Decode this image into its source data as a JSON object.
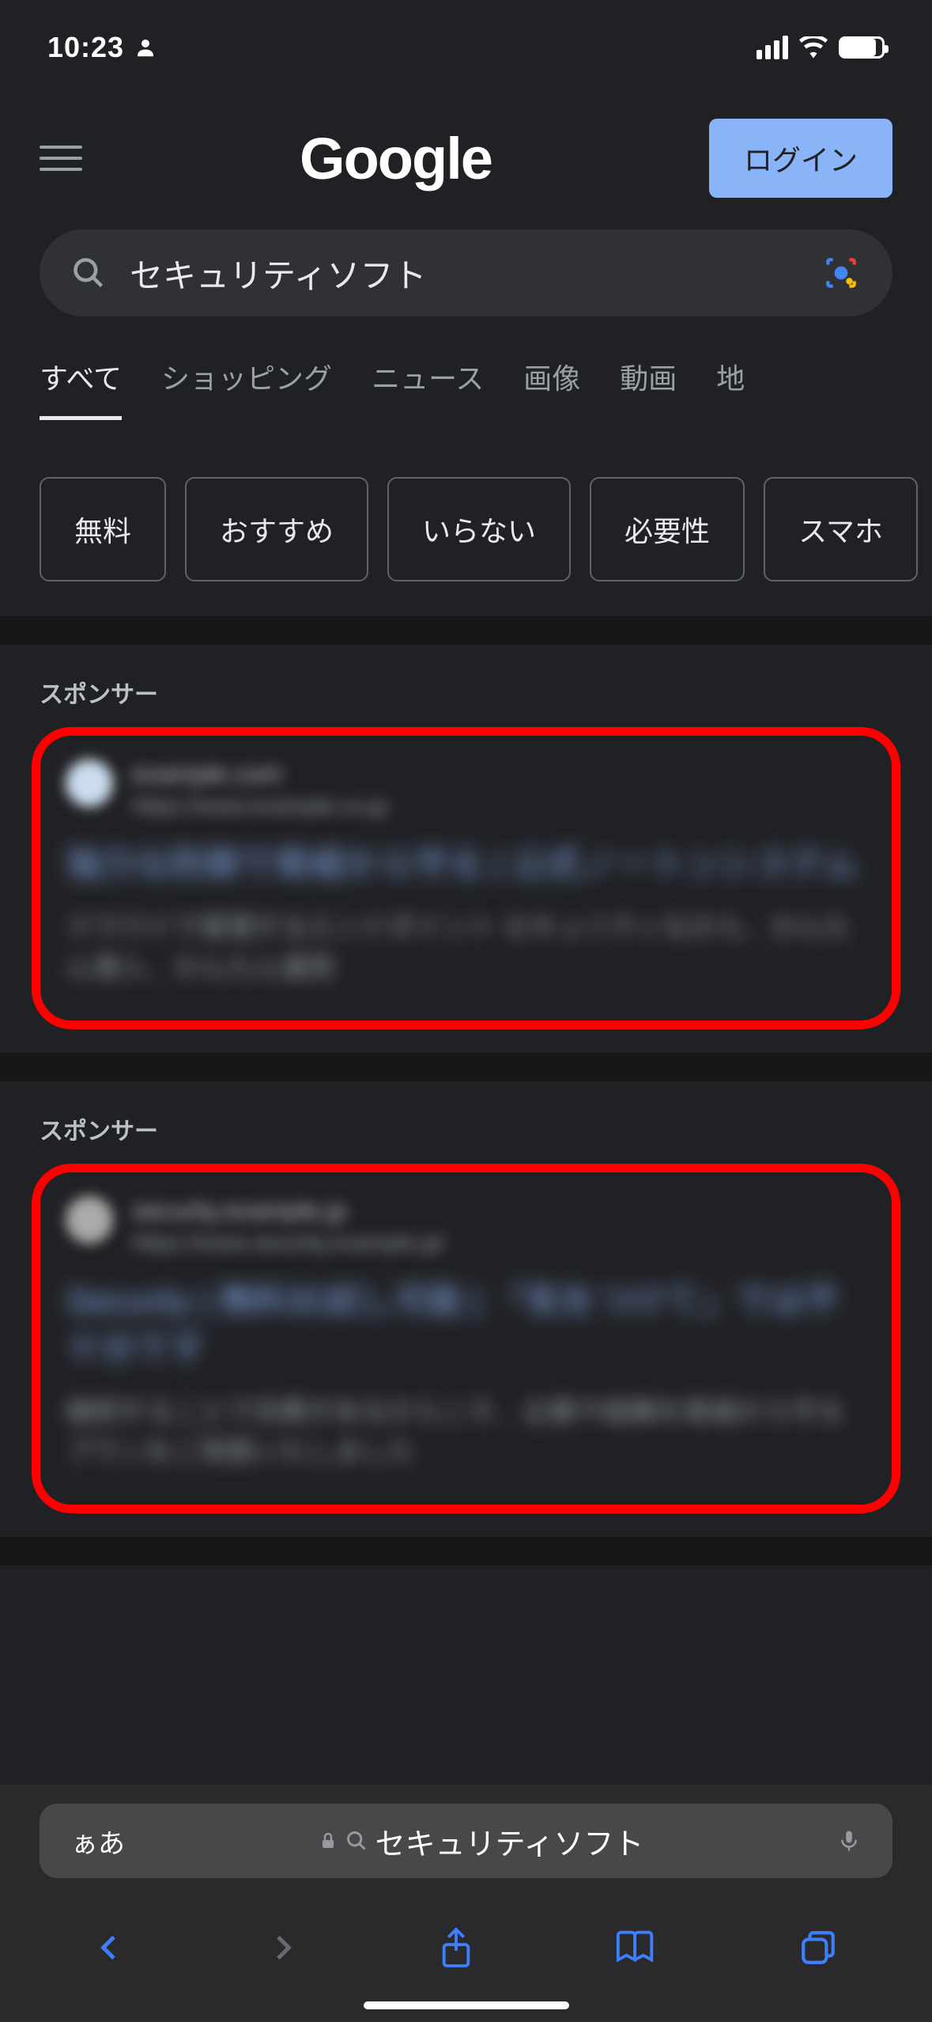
{
  "statusbar": {
    "time": "10:23"
  },
  "header": {
    "logo": "Google",
    "login": "ログイン"
  },
  "search": {
    "query": "セキュリティソフト"
  },
  "tabs": [
    "すべて",
    "ショッピング",
    "ニュース",
    "画像",
    "動画",
    "地"
  ],
  "chips": [
    "無料",
    "おすすめ",
    "いらない",
    "必要性",
    "スマホ"
  ],
  "sponsor_label": "スポンサー",
  "results": [
    {
      "domain": "example.com",
      "path": "https://www.example.co.jp",
      "title": "強力な防御で脅威から守る | 公式ノートンシステム",
      "desc": "クラウドで管理するエンドポイント セキュリティなから、かんたん導入、かんたん運用"
    },
    {
      "domain": "security.example.jp",
      "path": "https://www.security.example.jp/",
      "title": "Security | 無料お試し可能 | 「気をつけて」では不十分です",
      "desc": "継続することで効果があるからこそ、企業や組織を脅威から守るプランをご用意いたしました"
    }
  ],
  "browser": {
    "aa": "ぁあ",
    "address": "セキュリティソフト"
  }
}
